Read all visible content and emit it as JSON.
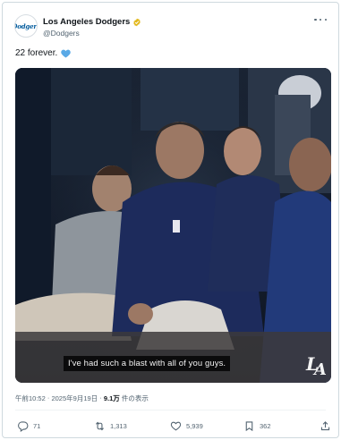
{
  "post": {
    "author": {
      "name": "Los Angeles Dodgers",
      "handle": "@Dodgers",
      "avatar_text": "Dodgers"
    },
    "text": "22 forever.",
    "emoji": "blue-heart",
    "video": {
      "caption": "I've had such a blast with all of you guys."
    },
    "meta": {
      "time": "午前10:52",
      "separator": "·",
      "date": "2025年9月19日",
      "views": "9.1万",
      "views_suffix": "件の表示"
    },
    "stats": {
      "replies": "71",
      "reposts": "1,313",
      "likes": "5,939",
      "bookmarks": "362"
    }
  },
  "colors": {
    "text": "#0f1419",
    "secondary": "#536471",
    "border": "#cfd9de",
    "verified": "#e2b719",
    "dodger_blue": "#005a9c",
    "heart": "#5aa9e6"
  },
  "icons": [
    "verified-badge-icon",
    "more-icon",
    "blue-heart-icon",
    "la-logo-icon",
    "reply-icon",
    "repost-icon",
    "like-icon",
    "bookmark-icon",
    "share-icon"
  ]
}
